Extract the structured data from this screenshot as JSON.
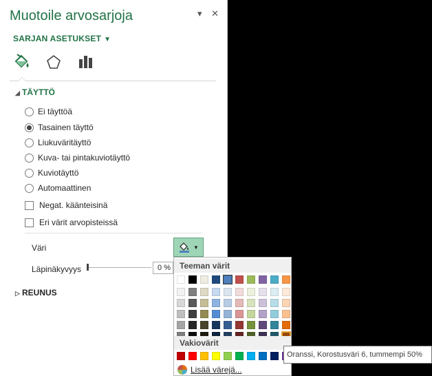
{
  "pane": {
    "title": "Muotoile arvosarjoja",
    "options_title": "SARJAN ASETUKSET",
    "pin_glyph": "▾",
    "close_glyph": "✕",
    "tabs": [
      {
        "name": "fill-line-icon"
      },
      {
        "name": "effects-icon"
      },
      {
        "name": "series-options-icon"
      }
    ]
  },
  "fill": {
    "section_label": "TÄYTTÖ",
    "options": [
      {
        "label": "Ei täyttöä",
        "selected": false
      },
      {
        "label": "Tasainen täyttö",
        "selected": true
      },
      {
        "label": "Liukuväritäyttö",
        "selected": false
      },
      {
        "label": "Kuva- tai pintakuviotäyttö",
        "selected": false
      },
      {
        "label": "Kuviotäyttö",
        "selected": false
      },
      {
        "label": "Automaattinen",
        "selected": false
      }
    ],
    "invert_label": "Negat. käänteisinä",
    "vary_label": "Eri värit arvopisteissä",
    "color_label": "Väri",
    "transparency_label": "Läpinäkyvyys",
    "transparency_value": "0 %",
    "transparency_level": 0
  },
  "border": {
    "section_label": "REUNUS"
  },
  "color_popup": {
    "theme_header": "Teeman värit",
    "standard_header": "Vakiovärit",
    "more_label": "Lisää värejä...",
    "theme_top": [
      "#FFFFFF",
      "#000000",
      "#EEECE1",
      "#1F497D",
      "#4F81BD",
      "#C0504D",
      "#9BBB59",
      "#8064A2",
      "#4BACC6",
      "#F79646"
    ],
    "theme_shades": [
      [
        "#F2F2F2",
        "#D8D8D8",
        "#BFBFBF",
        "#A5A5A5",
        "#7F7F7F"
      ],
      [
        "#7F7F7F",
        "#595959",
        "#3F3F3F",
        "#262626",
        "#0C0C0C"
      ],
      [
        "#DDD9C3",
        "#C4BD97",
        "#938953",
        "#494429",
        "#1D1B10"
      ],
      [
        "#C6D9F0",
        "#8DB3E2",
        "#548DD4",
        "#17365D",
        "#0F243E"
      ],
      [
        "#DBE5F1",
        "#B8CCE4",
        "#95B3D7",
        "#366092",
        "#244061"
      ],
      [
        "#F2DCDB",
        "#E5B9B7",
        "#D99694",
        "#953734",
        "#632423"
      ],
      [
        "#EBF1DD",
        "#D7E3BC",
        "#C3D69B",
        "#76923C",
        "#4F6128"
      ],
      [
        "#E5E0EC",
        "#CCC1D9",
        "#B2A2C7",
        "#5F497A",
        "#3F3151"
      ],
      [
        "#DBEEF3",
        "#B7DDE8",
        "#92CDDC",
        "#31859B",
        "#205867"
      ],
      [
        "#FDEADA",
        "#FBD5B5",
        "#FAC08F",
        "#E36C09",
        "#974806"
      ]
    ],
    "standard": [
      "#C00000",
      "#FF0000",
      "#FFC000",
      "#FFFF00",
      "#92D050",
      "#00B050",
      "#00B0F0",
      "#0070C0",
      "#002060",
      "#7030A0"
    ],
    "selected_top_index": 4
  },
  "tooltip": {
    "text": "Oranssi, Korostusväri 6, tummempi 50%"
  }
}
